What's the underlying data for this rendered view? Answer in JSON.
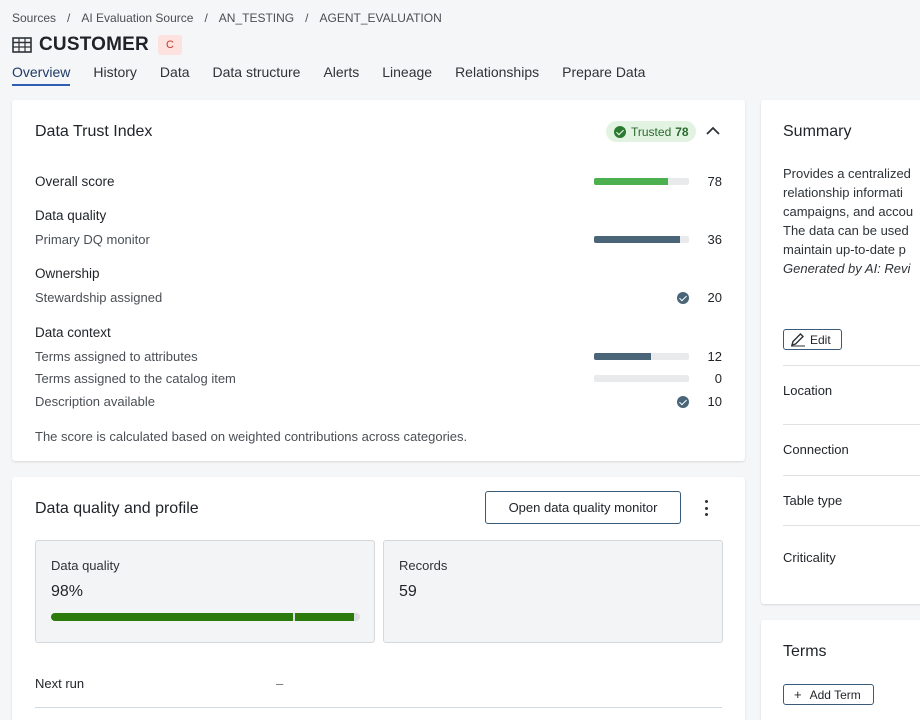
{
  "breadcrumb": [
    "Sources",
    "AI Evaluation Source",
    "AN_TESTING",
    "AGENT_EVALUATION"
  ],
  "breadcrumb_separator": "/",
  "page": {
    "title": "CUSTOMER",
    "badge": "C",
    "icon": "table-icon"
  },
  "tabs": [
    {
      "label": "Overview",
      "active": true
    },
    {
      "label": "History"
    },
    {
      "label": "Data"
    },
    {
      "label": "Data structure"
    },
    {
      "label": "Alerts"
    },
    {
      "label": "Lineage"
    },
    {
      "label": "Relationships"
    },
    {
      "label": "Prepare Data"
    }
  ],
  "trust": {
    "title": "Data Trust Index",
    "badge_label": "Trusted",
    "badge_score": "78",
    "rows": [
      {
        "label": "Overall score",
        "heading": true,
        "value": "78",
        "fill": 0.78,
        "indicator": "bar",
        "color": "#4caf50"
      },
      {
        "label": "Data quality",
        "heading": true
      },
      {
        "label": "Primary DQ monitor",
        "value": "36",
        "fill": 0.9,
        "indicator": "bar",
        "color": "#4a6478"
      },
      {
        "label": "Ownership",
        "heading": true
      },
      {
        "label": "Stewardship assigned",
        "value": "20",
        "indicator": "check"
      },
      {
        "label": "Data context",
        "heading": true
      },
      {
        "label": "Terms assigned to attributes",
        "value": "12",
        "fill": 0.6,
        "indicator": "bar",
        "color": "#4a6478"
      },
      {
        "label": "Terms assigned to the catalog item",
        "value": "0",
        "fill": 0,
        "indicator": "bar",
        "color": "#4a6478"
      },
      {
        "label": "Description available",
        "value": "10",
        "indicator": "check"
      }
    ],
    "footnote": "The score is calculated based on weighted contributions across categories."
  },
  "dq": {
    "title": "Data quality and profile",
    "open_button": "Open data quality monitor",
    "quality_label": "Data quality",
    "quality_value": "98%",
    "quality_fill": 0.98,
    "records_label": "Records",
    "records_value": "59",
    "next_run_label": "Next run",
    "next_run_value": "–"
  },
  "summary": {
    "title": "Summary",
    "lines": [
      "Provides a centralized",
      "relationship informati",
      "campaigns, and accou",
      "The data can be used",
      "maintain up-to-date p"
    ],
    "ai_line": "Generated by AI: Revi",
    "edit_label": "Edit",
    "meta": [
      "Location",
      "Connection",
      "Table type",
      "Criticality"
    ]
  },
  "terms": {
    "title": "Terms",
    "add_label": "Add Term"
  }
}
